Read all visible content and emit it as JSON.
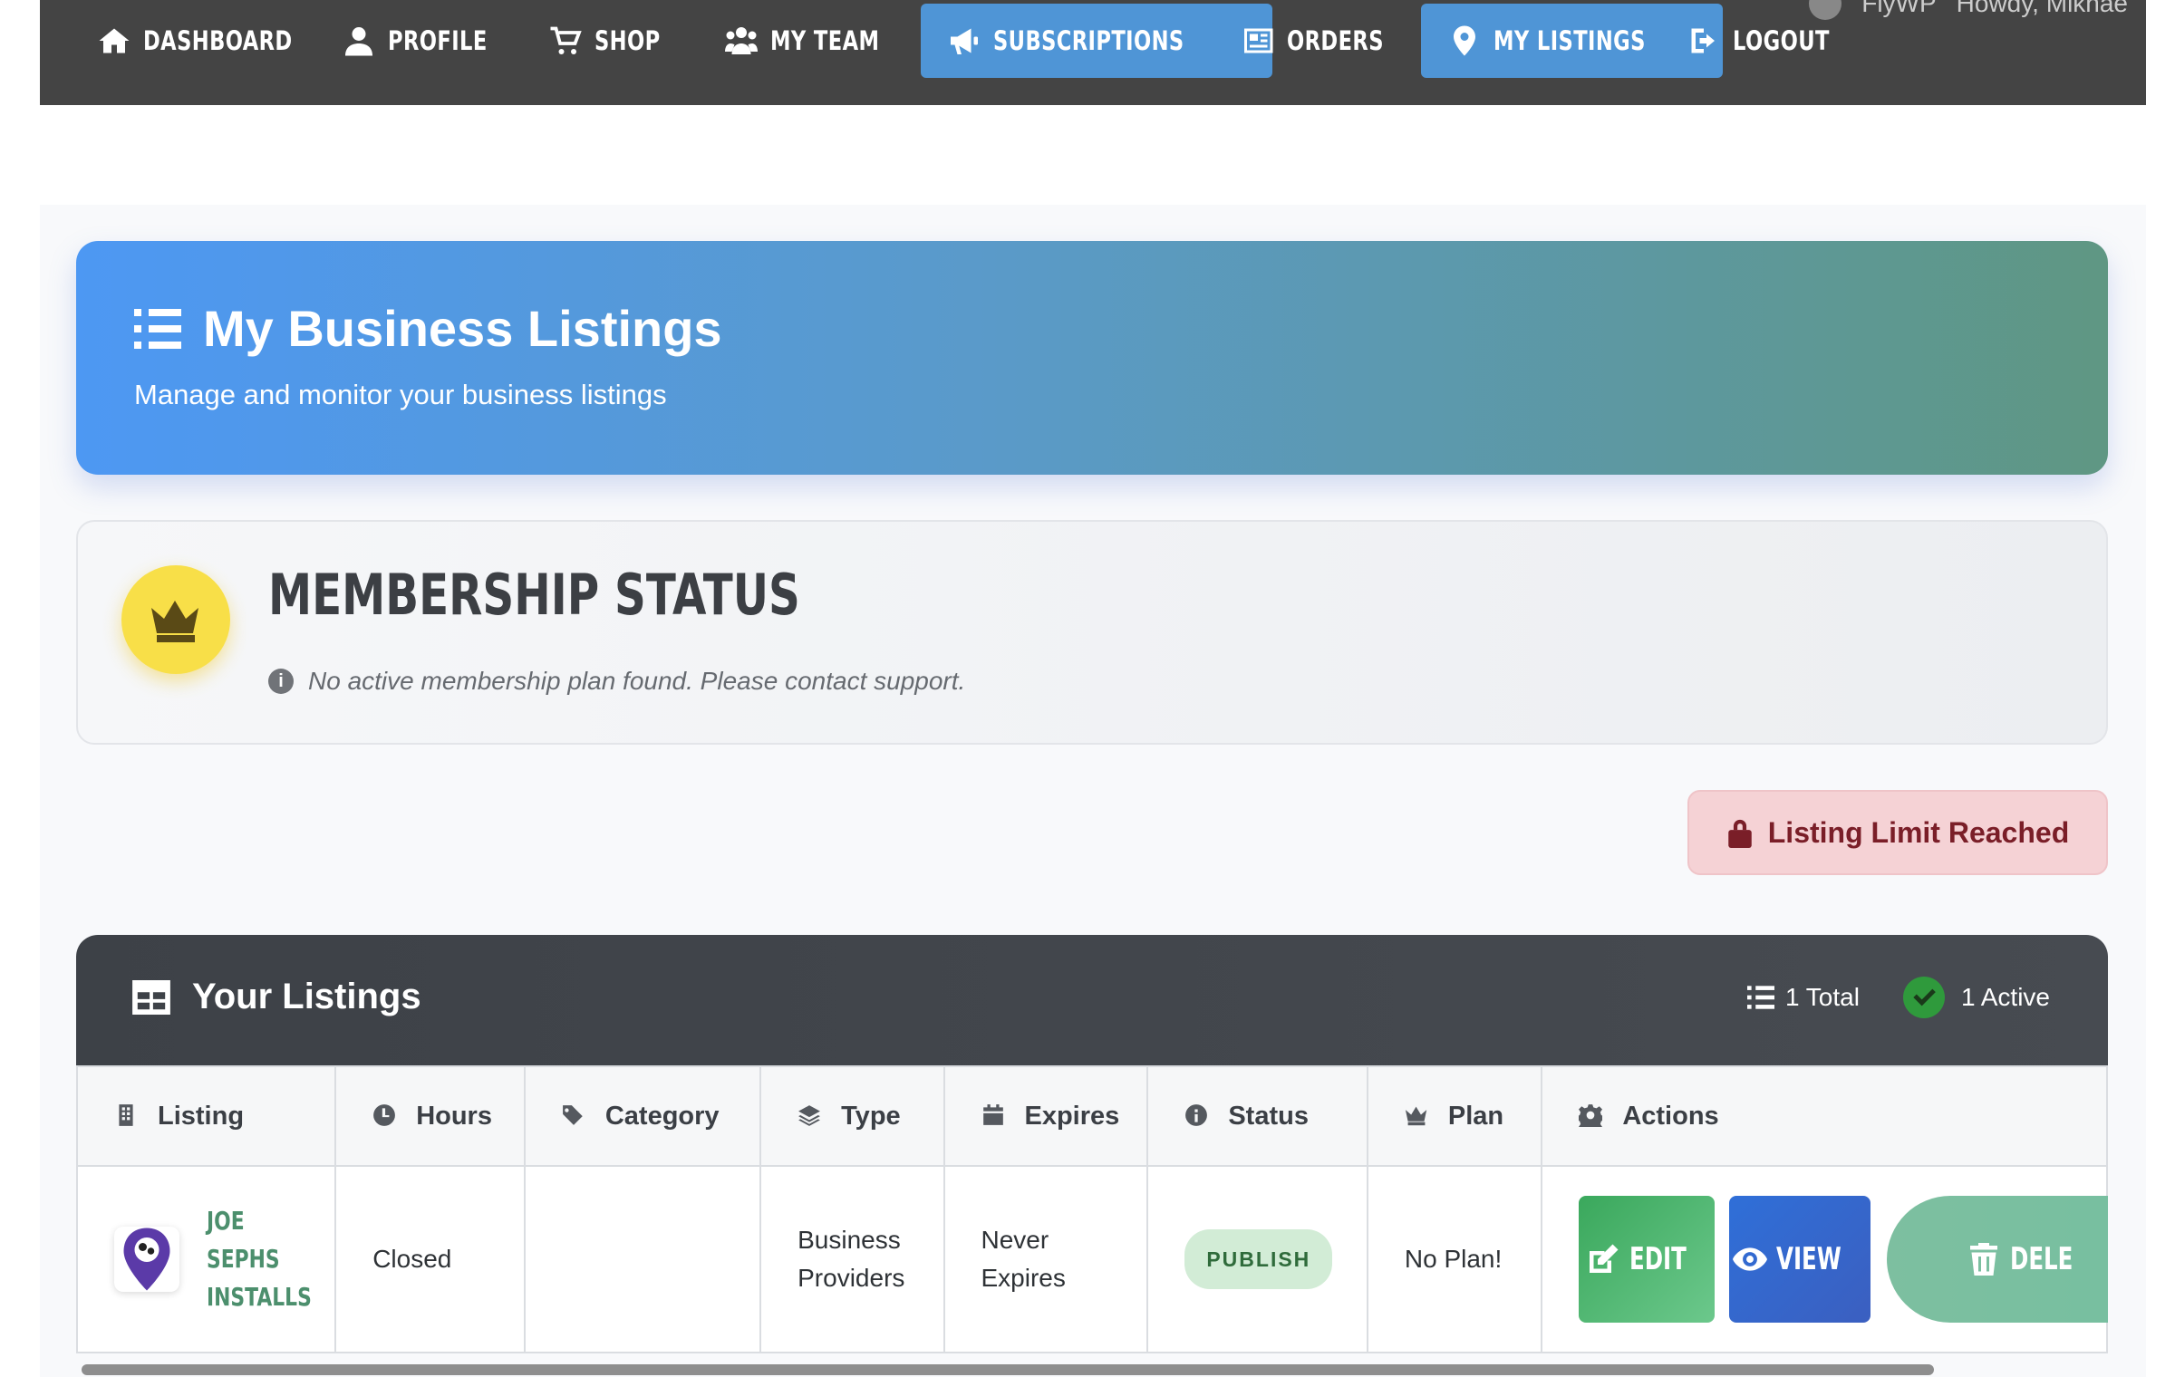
{
  "nav": {
    "items": [
      {
        "label": "DASHBOARD",
        "icon": "home-icon"
      },
      {
        "label": "PROFILE",
        "icon": "user-icon"
      },
      {
        "label": "SHOP",
        "icon": "cart-icon"
      },
      {
        "label": "MY TEAM",
        "icon": "users-icon"
      },
      {
        "label": "SUBSCRIPTIONS",
        "icon": "megaphone-icon",
        "active": true
      },
      {
        "label": "ORDERS",
        "icon": "newspaper-icon"
      },
      {
        "label": "MY LISTINGS",
        "icon": "map-pin-icon",
        "active": true
      },
      {
        "label": "LOGOUT",
        "icon": "logout-icon"
      }
    ],
    "admin_bar": {
      "left": "FlyWP",
      "right": "Howdy, Mikhae"
    }
  },
  "hero": {
    "title": "My Business Listings",
    "subtitle": "Manage and monitor your business listings"
  },
  "membership": {
    "title": "MEMBERSHIP STATUS",
    "note": "No active membership plan found. Please contact support."
  },
  "limit_badge": "Listing Limit Reached",
  "listings": {
    "title": "Your Listings",
    "total": "1 Total",
    "active": "1 Active",
    "columns": [
      "Listing",
      "Hours",
      "Category",
      "Type",
      "Expires",
      "Status",
      "Plan",
      "Actions"
    ],
    "rows": [
      {
        "name_lines": [
          "JOE",
          "SEPHS",
          "INSTALLS"
        ],
        "hours": "Closed",
        "category": "",
        "type_lines": [
          "Business",
          "Providers"
        ],
        "expires_lines": [
          "Never",
          "Expires"
        ],
        "status": "PUBLISH",
        "plan": "No Plan!",
        "actions": {
          "edit": "EDIT",
          "view": "VIEW",
          "delete": "DELE"
        }
      }
    ]
  },
  "colors": {
    "nav_bg": "#444444",
    "nav_active": "#4f95d6",
    "edit": "#4cb86c",
    "view": "#2f6fd8",
    "delete": "#7dbfa0",
    "limit_bg": "#f5d2d5",
    "limit_text": "#7a1e28"
  }
}
